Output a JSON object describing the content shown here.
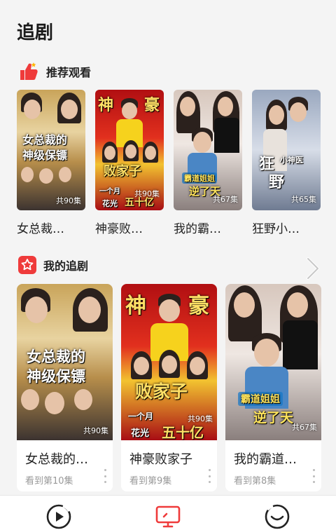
{
  "page": {
    "title": "追剧"
  },
  "recommend": {
    "label": "推荐观看",
    "items": [
      {
        "title": "女总裁…",
        "poster_text": [
          "女总裁的",
          "神级保镖"
        ],
        "episodes": "共90集"
      },
      {
        "title": "神豪败…",
        "poster_text": [
          "神",
          "豪",
          "败家子"
        ],
        "sub_text": [
          "一个月",
          "花光",
          "五十亿"
        ],
        "episodes": "共90集"
      },
      {
        "title": "我的霸…",
        "poster_text": [
          "霸道姐姐",
          "逆了天"
        ],
        "episodes": "共67集"
      },
      {
        "title": "狂野小…",
        "poster_text": [
          "狂",
          "野",
          "小神医"
        ],
        "episodes": "共65集"
      }
    ]
  },
  "my_shows": {
    "label": "我的追剧",
    "items": [
      {
        "title": "女总裁的…",
        "progress": "看到第10集",
        "poster_text": [
          "女总裁的",
          "神级保镖"
        ],
        "episodes": "共90集"
      },
      {
        "title": "神豪败家子",
        "progress": "看到第9集",
        "poster_text": [
          "神",
          "豪",
          "败家子"
        ],
        "sub_text": [
          "一个月",
          "花光",
          "五十亿"
        ],
        "episodes": "共90集"
      },
      {
        "title": "我的霸道…",
        "progress": "看到第8集",
        "poster_text": [
          "霸道姐姐",
          "逆了天"
        ],
        "episodes": "共67集"
      }
    ]
  },
  "nav": {
    "icons": [
      "play-icon",
      "tv-icon",
      "smile-icon"
    ]
  },
  "colors": {
    "accent": "#ef3b3b",
    "muted": "#999999"
  }
}
